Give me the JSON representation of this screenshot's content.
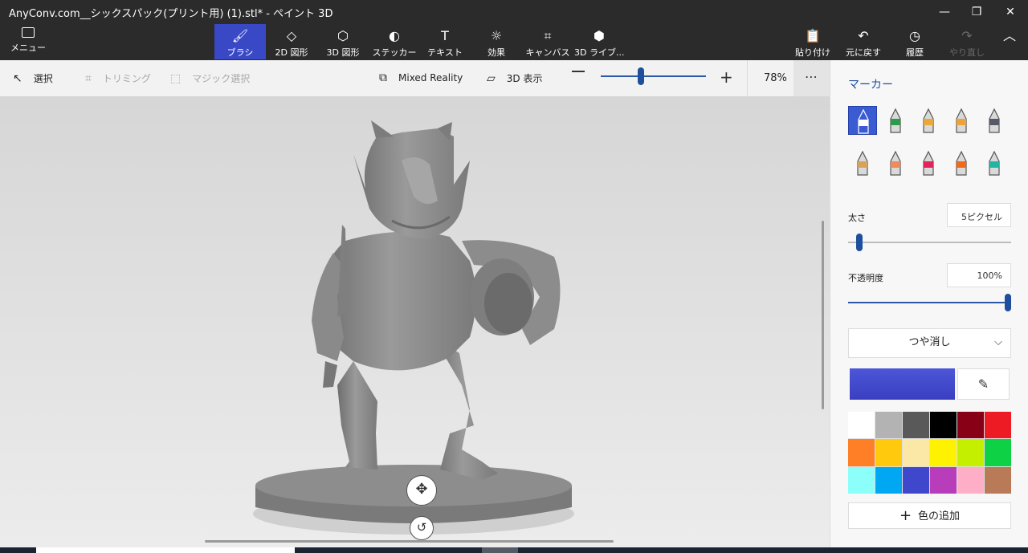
{
  "window": {
    "title": "AnyConv.com__シックスパック(プリント用) (1).stl* - ペイント 3D",
    "minimize_glyph": "—",
    "maximize_glyph": "❐",
    "close_glyph": "✕"
  },
  "ribbon": {
    "menu_label": "メニュー",
    "tools": [
      {
        "label": "ブラシ",
        "icon": "brush-icon",
        "glyph": "🖌",
        "active": true
      },
      {
        "label": "2D 図形",
        "icon": "2d-shapes-icon",
        "glyph": "◇",
        "active": false
      },
      {
        "label": "3D 図形",
        "icon": "3d-shapes-icon",
        "glyph": "⬡",
        "active": false
      },
      {
        "label": "ステッカー",
        "icon": "sticker-icon",
        "glyph": "◐",
        "active": false
      },
      {
        "label": "テキスト",
        "icon": "text-icon",
        "glyph": "T",
        "active": false
      },
      {
        "label": "効果",
        "icon": "effects-icon",
        "glyph": "☼",
        "active": false
      },
      {
        "label": "キャンバス",
        "icon": "canvas-icon",
        "glyph": "⌗",
        "active": false
      },
      {
        "label": "3D ライブ...",
        "icon": "3d-library-icon",
        "glyph": "⬢",
        "active": false
      }
    ],
    "right_tools": [
      {
        "label": "貼り付け",
        "icon": "paste-icon",
        "glyph": "📋",
        "enabled": true
      },
      {
        "label": "元に戻す",
        "icon": "undo-icon",
        "glyph": "↶",
        "enabled": true
      },
      {
        "label": "履歴",
        "icon": "history-icon",
        "glyph": "◷",
        "enabled": true
      },
      {
        "label": "やり直し",
        "icon": "redo-icon",
        "glyph": "↷",
        "enabled": false
      }
    ],
    "collapse_glyph": "︿"
  },
  "subbar": {
    "select": "選択",
    "crop": "トリミング",
    "magic_select": "マジック選択",
    "mixed_reality": "Mixed Reality",
    "view_3d": "3D 表示",
    "zoom": "78%",
    "more": "⋯"
  },
  "panel": {
    "title": "マーカー",
    "brushes": [
      {
        "icon": "marker-icon",
        "color": "#ffffff",
        "selected": true
      },
      {
        "icon": "calligraphy-pen-icon",
        "color": "#2a9d4b",
        "selected": false
      },
      {
        "icon": "oil-brush-icon",
        "color": "#e8a93a",
        "selected": false
      },
      {
        "icon": "watercolor-icon",
        "color": "#f0a23a",
        "selected": false
      },
      {
        "icon": "pixel-pen-icon",
        "color": "#555a66",
        "selected": false
      },
      {
        "icon": "pencil-icon",
        "color": "#d9a25a",
        "selected": false
      },
      {
        "icon": "eraser-icon",
        "color": "#f08a5a",
        "selected": false
      },
      {
        "icon": "crayon-icon",
        "color": "#e3245b",
        "selected": false
      },
      {
        "icon": "spray-can-icon",
        "color": "#f06a1a",
        "selected": false
      },
      {
        "icon": "fill-bucket-icon",
        "color": "#22b5a2",
        "selected": false
      }
    ],
    "thickness_label": "太さ",
    "thickness_value": "5ピクセル",
    "thickness_fraction": 0.05,
    "opacity_label": "不透明度",
    "opacity_value": "100%",
    "opacity_fraction": 1.0,
    "finish": "つや消し",
    "current_color": "#3a3fc0",
    "palette": [
      "#ffffff",
      "#b3b3b3",
      "#595959",
      "#000000",
      "#880015",
      "#ed1c24",
      "#ff7f27",
      "#ffc90e",
      "#fbe8a6",
      "#fff200",
      "#c4f000",
      "#0ed145",
      "#8cfffb",
      "#00a8f3",
      "#3f48cc",
      "#b83dba",
      "#ffaec8",
      "#b97a57"
    ],
    "add_color": "色の追加"
  },
  "colors": {
    "accent": "#3949c6",
    "ribbon": "#2b2b2b"
  }
}
